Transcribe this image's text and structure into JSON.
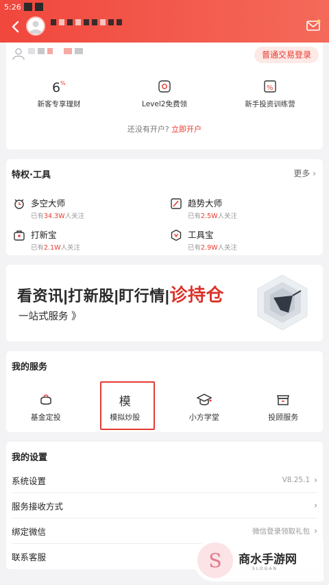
{
  "status": {
    "time": "5:26"
  },
  "colors": {
    "brand": "#f1473d",
    "accent": "#e8392d"
  },
  "account": {
    "login_button": "普通交易登录"
  },
  "features": [
    {
      "icon": "six-percent-icon",
      "label": "新客专享理财"
    },
    {
      "icon": "level2-icon",
      "label": "Level2免费领"
    },
    {
      "icon": "training-icon",
      "label": "新手投资训练营"
    }
  ],
  "open_account": {
    "prompt": "还没有开户?",
    "link": "立即开户"
  },
  "privileges": {
    "title": "特权·工具",
    "more": "更多",
    "tools": [
      {
        "name": "多空大师",
        "prefix": "已有",
        "count": "34.3W",
        "suffix": "人关注"
      },
      {
        "name": "趋势大师",
        "prefix": "已有",
        "count": "2.5W",
        "suffix": "人关注"
      },
      {
        "name": "打新宝",
        "prefix": "已有",
        "count": "2.1W",
        "suffix": "人关注"
      },
      {
        "name": "工具宝",
        "prefix": "已有",
        "count": "2.9W",
        "suffix": "人关注"
      }
    ]
  },
  "banner": {
    "text1": "看资讯|打新股|盯行情|",
    "text2": "诊持仓",
    "sub": "一站式服务 》"
  },
  "services": {
    "title": "我的服务",
    "items": [
      {
        "label": "基金定投",
        "icon": "piggy-bank-icon"
      },
      {
        "label": "模拟炒股",
        "glyph": "模"
      },
      {
        "label": "小方学堂",
        "icon": "graduation-cap-icon"
      },
      {
        "label": "投顾服务",
        "icon": "store-icon"
      }
    ]
  },
  "settings": {
    "title": "我的设置",
    "rows": [
      {
        "name": "系统设置",
        "value": "V8.25.1"
      },
      {
        "name": "服务接收方式",
        "value": ""
      },
      {
        "name": "绑定微信",
        "value": "微信登录领取礼包"
      },
      {
        "name": "联系客服",
        "value": ""
      }
    ]
  },
  "watermark": {
    "text": "商水手游网",
    "sub": "SLOGAN"
  }
}
